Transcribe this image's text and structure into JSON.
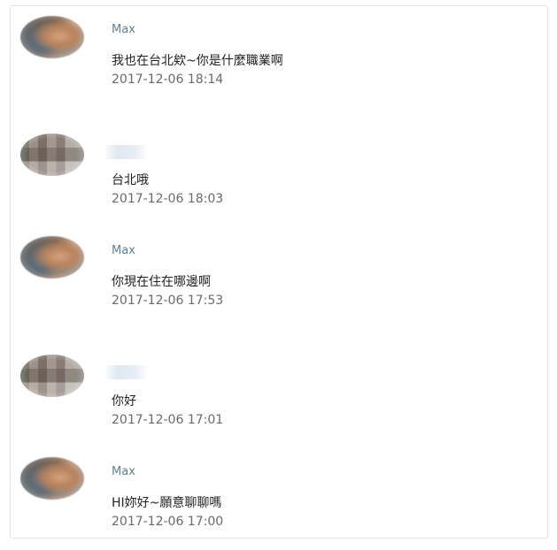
{
  "messages": [
    {
      "sender": "Max",
      "sender_visible": true,
      "text": "我也在台北欸~你是什麼職業啊",
      "timestamp": "2017-12-06 18:14",
      "avatar": "avatar-max"
    },
    {
      "sender": "",
      "sender_visible": false,
      "text": "台北哦",
      "timestamp": "2017-12-06 18:03",
      "avatar": "avatar-blurred"
    },
    {
      "sender": "Max",
      "sender_visible": true,
      "text": "你現在住在哪邊啊",
      "timestamp": "2017-12-06 17:53",
      "avatar": "avatar-max"
    },
    {
      "sender": "",
      "sender_visible": false,
      "text": "你好",
      "timestamp": "2017-12-06 17:01",
      "avatar": "avatar-blurred"
    },
    {
      "sender": "Max",
      "sender_visible": true,
      "text": "HI妳好~願意聊聊嗎",
      "timestamp": "2017-12-06 17:00",
      "avatar": "avatar-max"
    }
  ]
}
